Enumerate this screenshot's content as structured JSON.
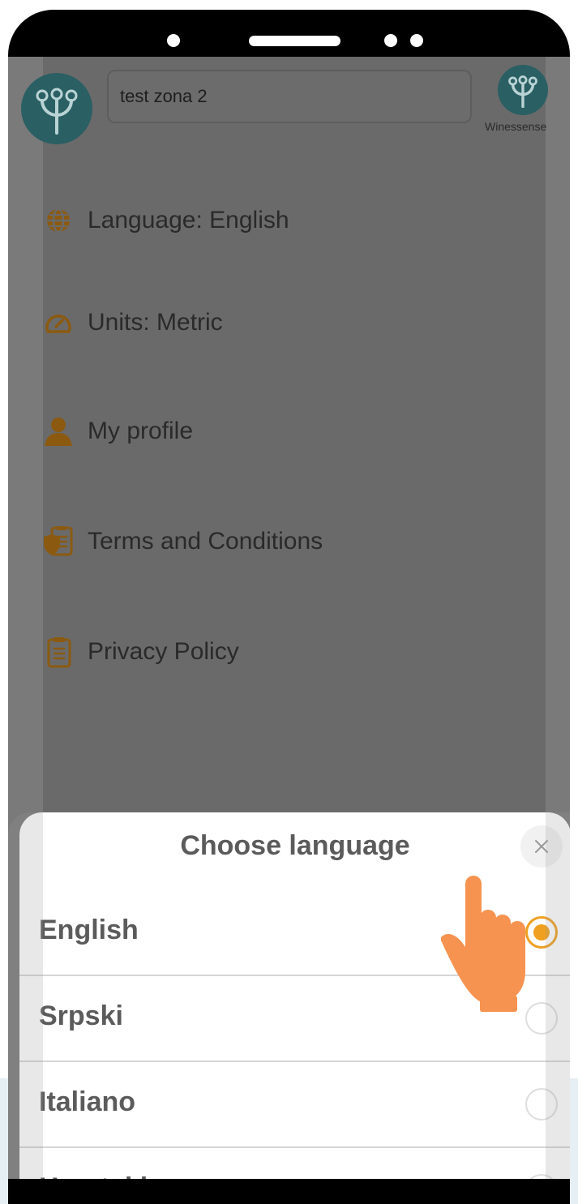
{
  "header": {
    "zone_value": "test zona 2",
    "brand_name": "Winessense"
  },
  "menu": {
    "items": [
      {
        "label": "Language: English",
        "icon": "globe-icon"
      },
      {
        "label": "Units: Metric",
        "icon": "speedometer-icon"
      },
      {
        "label": "My profile",
        "icon": "user-icon"
      },
      {
        "label": "Terms and Conditions",
        "icon": "document-shield-icon"
      },
      {
        "label": "Privacy Policy",
        "icon": "clipboard-icon"
      }
    ]
  },
  "language_sheet": {
    "title": "Choose language",
    "options": [
      {
        "label": "English",
        "selected": true
      },
      {
        "label": "Srpski",
        "selected": false
      },
      {
        "label": "Italiano",
        "selected": false
      },
      {
        "label": "Hrvatski",
        "selected": false
      }
    ]
  },
  "colors": {
    "accent": "#f0a020",
    "brand_teal": "#2a5f63",
    "pointer_hand": "#f79350"
  }
}
